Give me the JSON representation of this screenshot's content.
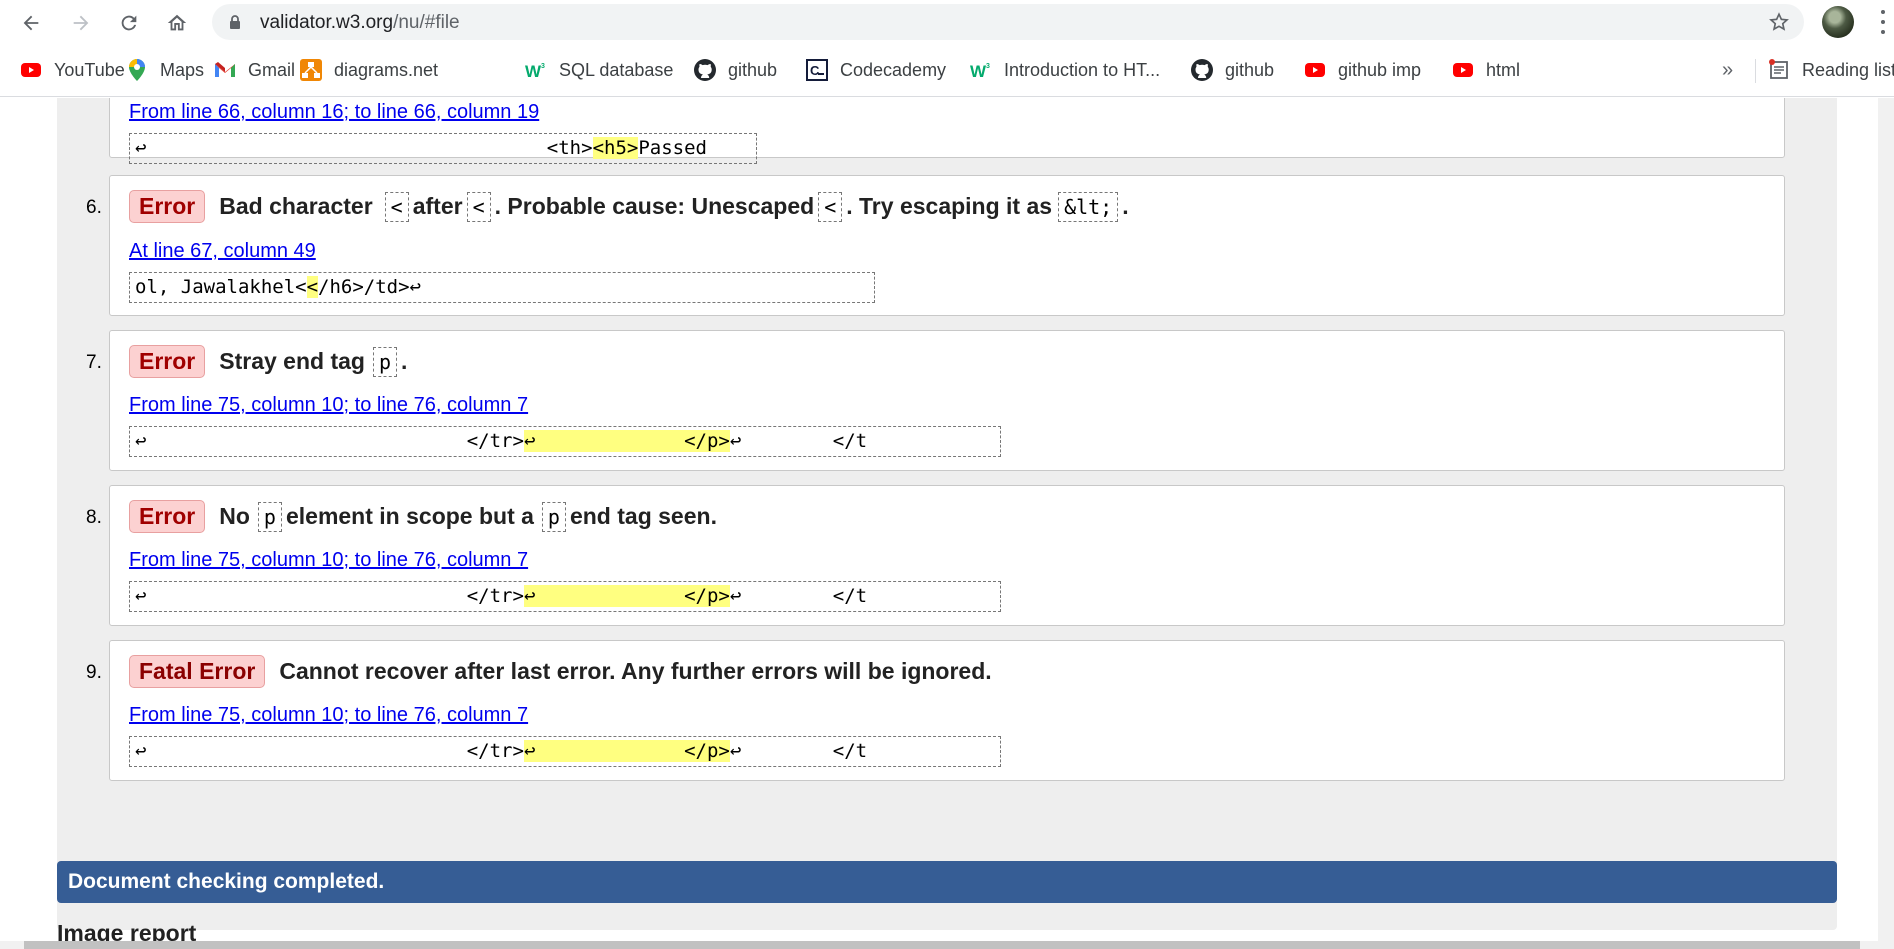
{
  "browser": {
    "url_host": "validator.w3.org",
    "url_path": "/nu/#file"
  },
  "bookmarks": [
    {
      "label": "YouTube",
      "icon": "youtube-icon"
    },
    {
      "label": "Maps",
      "icon": "maps-icon"
    },
    {
      "label": "Gmail",
      "icon": "gmail-icon"
    },
    {
      "label": "diagrams.net",
      "icon": "diagrams-icon"
    },
    {
      "label": "SQL database",
      "icon": "w3schools-icon"
    },
    {
      "label": "github",
      "icon": "github-icon"
    },
    {
      "label": "Codecademy",
      "icon": "codecademy-icon"
    },
    {
      "label": "Introduction to HT...",
      "icon": "w3schools-icon"
    },
    {
      "label": "github",
      "icon": "github-icon"
    },
    {
      "label": "github imp",
      "icon": "youtube-icon"
    },
    {
      "label": "html",
      "icon": "youtube-icon"
    }
  ],
  "bookmarks_overflow": "»",
  "reading_list": "Reading list",
  "partial_message": {
    "location": "From line 66, column 16; to line 66, column 19",
    "extract_pre": "↩                                   <th>",
    "extract_hl": "<h5>",
    "extract_post": "Passed"
  },
  "messages": [
    {
      "number": "6.",
      "type": "Error",
      "parts": [
        "Bad character",
        "<",
        "after",
        "<",
        ". Probable cause: Unescaped",
        "<",
        ". Try escaping it as",
        "&lt;",
        "."
      ],
      "location": "At line 67, column 49",
      "extract_pre": "ol, Jawalakhel<",
      "extract_hl": "<",
      "extract_post": "/h6>/td>↩"
    },
    {
      "number": "7.",
      "type": "Error",
      "parts": [
        "Stray end tag",
        "p",
        "."
      ],
      "location": "From line 75, column 10; to line 76, column 7",
      "extract_pre": "↩                            </tr>",
      "extract_hl": "↩             </p>",
      "extract_post": "↩        </t"
    },
    {
      "number": "8.",
      "type": "Error",
      "parts": [
        "No",
        "p",
        "element in scope but a",
        "p",
        "end tag seen."
      ],
      "location": "From line 75, column 10; to line 76, column 7",
      "extract_pre": "↩                            </tr>",
      "extract_hl": "↩             </p>",
      "extract_post": "↩        </t"
    },
    {
      "number": "9.",
      "type": "Fatal Error",
      "parts": [
        "Cannot recover after last error. Any further errors will be ignored."
      ],
      "location": "From line 75, column 10; to line 76, column 7",
      "extract_pre": "↩                            </tr>",
      "extract_hl": "↩             </p>",
      "extract_post": "↩        </t"
    }
  ],
  "status_bar": "Document checking completed.",
  "next_section": "Image report",
  "colors": {
    "error_badge_bg": "#fcd1d1",
    "highlight": "#ffff80",
    "completed_bar": "#365d95",
    "link": "#0000ee"
  }
}
